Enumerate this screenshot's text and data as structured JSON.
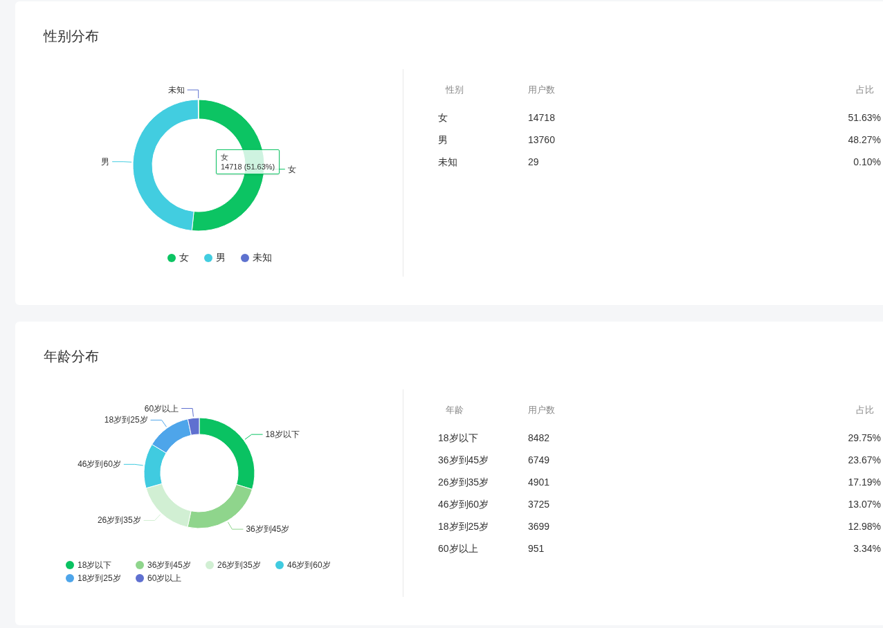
{
  "sections": [
    {
      "title": "性别分布",
      "chart_data": {
        "type": "donut",
        "categories": [
          "女",
          "男",
          "未知"
        ],
        "values": [
          51.63,
          48.27,
          0.1
        ],
        "colors": [
          "#0cc463",
          "#42cde0",
          "#5e72cf"
        ]
      },
      "tooltip": {
        "title": "女",
        "value": "14718 (51.63%)"
      },
      "legend": [
        {
          "label": "女",
          "color": "#0cc463"
        },
        {
          "label": "男",
          "color": "#42cde0"
        },
        {
          "label": "未知",
          "color": "#5e72cf"
        }
      ],
      "table": {
        "columns": [
          "性别",
          "用户数",
          "占比"
        ],
        "rows": [
          [
            "女",
            "14718",
            "51.63%"
          ],
          [
            "男",
            "13760",
            "48.27%"
          ],
          [
            "未知",
            "29",
            "0.10%"
          ]
        ]
      }
    },
    {
      "title": "年龄分布",
      "chart_data": {
        "type": "donut",
        "categories": [
          "18岁以下",
          "36岁到45岁",
          "26岁到35岁",
          "46岁到60岁",
          "18岁到25岁",
          "60岁以上"
        ],
        "values": [
          29.75,
          23.67,
          17.19,
          13.07,
          12.98,
          3.34
        ],
        "colors": [
          "#0ac262",
          "#8fd58c",
          "#d1efd3",
          "#40cbe0",
          "#4ea5ea",
          "#5f70d0"
        ]
      },
      "legend": [
        {
          "label": "18岁以下",
          "color": "#0ac262"
        },
        {
          "label": "36岁到45岁",
          "color": "#8fd58c"
        },
        {
          "label": "26岁到35岁",
          "color": "#d1efd3"
        },
        {
          "label": "46岁到60岁",
          "color": "#40cbe0"
        },
        {
          "label": "18岁到25岁",
          "color": "#4ea5ea"
        },
        {
          "label": "60岁以上",
          "color": "#5f70d0"
        }
      ],
      "table": {
        "columns": [
          "年龄",
          "用户数",
          "占比"
        ],
        "rows": [
          [
            "18岁以下",
            "8482",
            "29.75%"
          ],
          [
            "36岁到45岁",
            "6749",
            "23.67%"
          ],
          [
            "26岁到35岁",
            "4901",
            "17.19%"
          ],
          [
            "46岁到60岁",
            "3725",
            "13.07%"
          ],
          [
            "18岁到25岁",
            "3699",
            "12.98%"
          ],
          [
            "60岁以上",
            "951",
            "3.34%"
          ]
        ]
      }
    }
  ]
}
